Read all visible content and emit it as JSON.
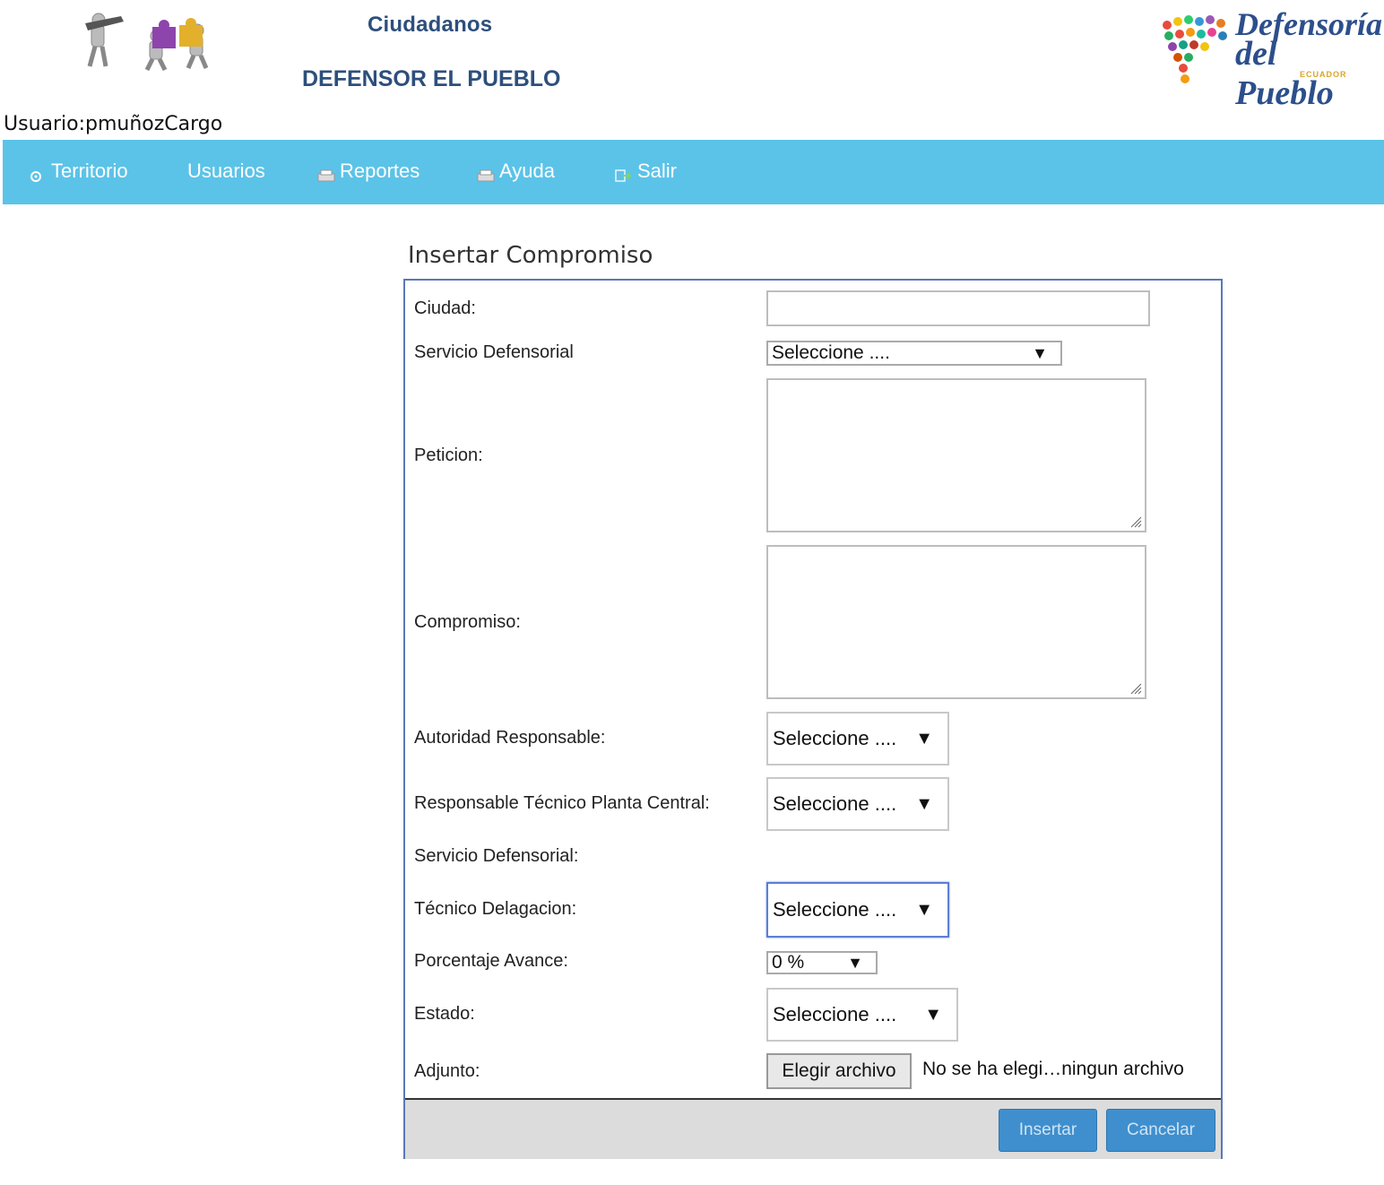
{
  "header": {
    "brand_line1": "Ciudadanos",
    "brand_line2": "DEFENSOR EL PUEBLO",
    "logo_right_line1": "Defensoría",
    "logo_right_line2": "del Pueblo",
    "logo_right_line3": "ECUADOR"
  },
  "user": {
    "line": "Usuario:pmuñozCargo"
  },
  "nav": {
    "items": [
      {
        "label": "Territorio",
        "icon": "gear-icon"
      },
      {
        "label": "Usuarios",
        "icon": ""
      },
      {
        "label": "Reportes",
        "icon": "printer-icon"
      },
      {
        "label": "Ayuda",
        "icon": "printer-icon"
      },
      {
        "label": "Salir",
        "icon": "exit-icon"
      }
    ]
  },
  "form": {
    "title": "Insertar Compromiso",
    "labels": {
      "ciudad": "Ciudad:",
      "servicio1": "Servicio Defensorial",
      "peticion": "Peticion:",
      "compromiso": "Compromiso:",
      "autoridad": "Autoridad Responsable:",
      "responsable": "Responsable Técnico Planta Central:",
      "servicio2": "Servicio Defensorial:",
      "tecnico": "Técnico Delagacion:",
      "porcentaje": "Porcentaje Avance:",
      "estado": "Estado:",
      "adjunto": "Adjunto:"
    },
    "values": {
      "ciudad": "",
      "servicio1": "Seleccione ....",
      "peticion": "",
      "compromiso": "",
      "autoridad": "Seleccione ....",
      "responsable": "Seleccione ....",
      "tecnico": "Seleccione ....",
      "porcentaje": "0 %",
      "estado": "Seleccione ...."
    },
    "file_button": "Elegir archivo",
    "file_status": "No se ha elegi…ningun archivo",
    "insert_button": "Insertar",
    "cancel_button": "Cancelar",
    "dropdown_arrow": "▼"
  }
}
